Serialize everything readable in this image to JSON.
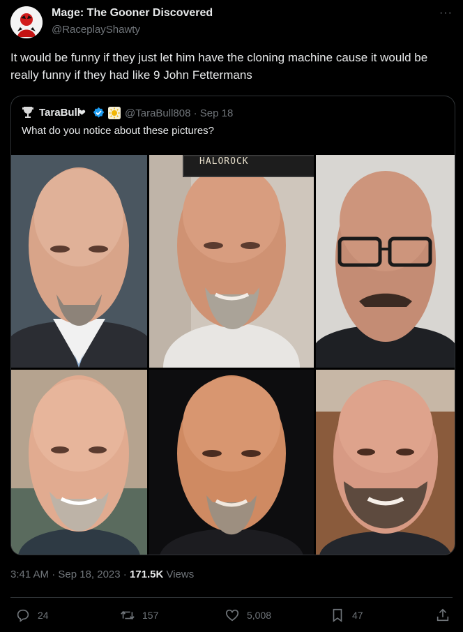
{
  "author": {
    "name": "Mage: The Gooner Discovered",
    "handle": "@RaceplayShawty"
  },
  "more_label": "···",
  "tweet_text": "It would be funny if they just let him have the cloning machine cause it would be really funny if they had like 9 John Fettermans",
  "quote": {
    "name": "TaraBull",
    "heart": "❤",
    "handle_date": "@TaraBull808 · Sep 18",
    "text": "What do you notice about these pictures?",
    "sign_text": "HALOROCK"
  },
  "meta": {
    "timestamp": "3:41 AM · Sep 18, 2023 · ",
    "views_count": "171.5K",
    "views_label": " Views"
  },
  "actions": {
    "replies": "24",
    "reposts": "157",
    "likes": "5,008",
    "bookmarks": "47"
  },
  "colors": {
    "background": "#000000",
    "text": "#e7e9ea",
    "muted": "#71767b",
    "border": "#2f3336",
    "verified": "#1d9bf0"
  }
}
